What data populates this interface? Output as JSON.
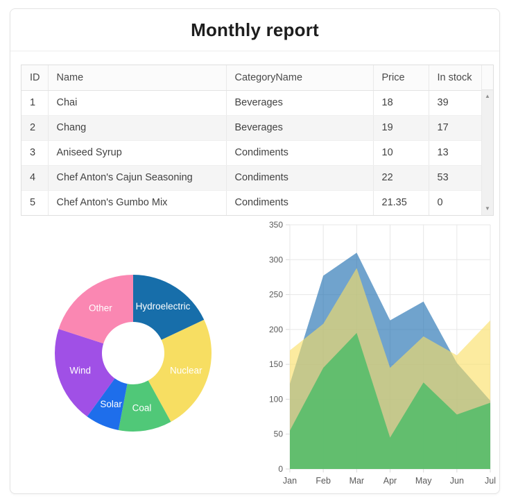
{
  "page": {
    "title": "Monthly report"
  },
  "table": {
    "columns": [
      "ID",
      "Name",
      "CategoryName",
      "Price",
      "In stock"
    ],
    "rows": [
      [
        "1",
        "Chai",
        "Beverages",
        "18",
        "39"
      ],
      [
        "2",
        "Chang",
        "Beverages",
        "19",
        "17"
      ],
      [
        "3",
        "Aniseed Syrup",
        "Condiments",
        "10",
        "13"
      ],
      [
        "4",
        "Chef Anton's Cajun Seasoning",
        "Condiments",
        "22",
        "53"
      ],
      [
        "5",
        "Chef Anton's Gumbo Mix",
        "Condiments",
        "21.35",
        "0"
      ]
    ],
    "scrollbar": {
      "up_icon": "▲",
      "down_icon": "▼"
    }
  },
  "chart_data": [
    {
      "type": "pie",
      "subtype": "donut",
      "labels": [
        "Hydroelectric",
        "Nuclear",
        "Coal",
        "Solar",
        "Wind",
        "Other"
      ],
      "values": [
        18,
        24,
        11,
        7,
        20,
        20
      ],
      "colors": [
        "#176eaa",
        "#f7de62",
        "#50c878",
        "#1e6eeb",
        "#a050e6",
        "#fa87b2"
      ],
      "label_color": "#ffffff",
      "start_angle_deg": 0,
      "inner_radius_ratio": 0.4,
      "legend_position": "none"
    },
    {
      "type": "area",
      "x": [
        "Jan",
        "Feb",
        "Mar",
        "Apr",
        "May",
        "Jun",
        "Jul"
      ],
      "series": [
        {
          "name": "blue",
          "values": [
            122,
            277,
            310,
            213,
            240,
            152,
            98
          ],
          "fill": "rgba(35,113,178,0.65)"
        },
        {
          "name": "yellow",
          "values": [
            170,
            208,
            288,
            145,
            190,
            163,
            213
          ],
          "fill": "rgba(250,222,100,0.62)"
        },
        {
          "name": "green",
          "values": [
            55,
            145,
            195,
            45,
            124,
            78,
            95
          ],
          "fill": "rgba(80,188,105,0.85)"
        }
      ],
      "ylim": [
        0,
        350
      ],
      "ytick_step": 50,
      "grid": true,
      "legend_position": "none",
      "axis_color": "#595959",
      "grid_color": "#e7e7e7"
    }
  ]
}
